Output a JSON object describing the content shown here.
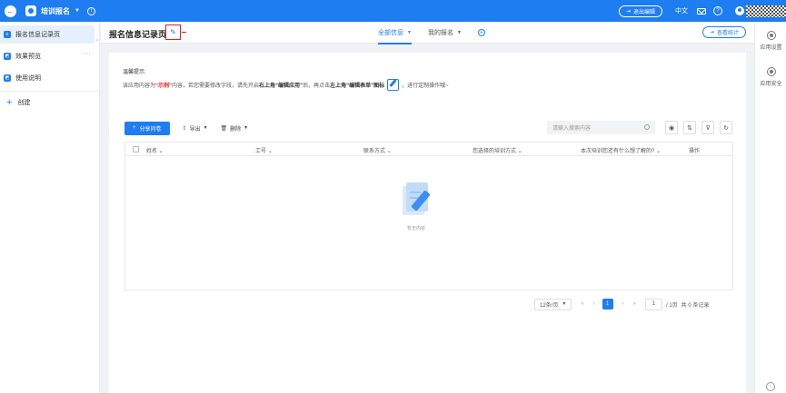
{
  "topbar": {
    "app_name": "培训报名",
    "exit_edit": "退出编辑",
    "language": "中文"
  },
  "sidebar": {
    "items": [
      {
        "label": "报名信息记录页"
      },
      {
        "label": "效果预览"
      },
      {
        "label": "使用说明"
      }
    ],
    "more": "···",
    "create": "创建"
  },
  "header": {
    "title": "报名信息记录页",
    "tabs": [
      {
        "label": "全部信息"
      },
      {
        "label": "我的报名"
      }
    ],
    "stats_button": "查看统计"
  },
  "tip": {
    "title": "温馨提示:",
    "p1": "该应用内容为",
    "p2": "“示例”",
    "p3": "内容，若您需要修改字段，请先开启",
    "p4": "右上角“编辑应用”",
    "p5": "后，再点击",
    "p6": "左上角“编辑表单”图标",
    "p7": "，进行定制操作哦~"
  },
  "toolbar": {
    "share_label": "分享问卷",
    "export_label": "导出",
    "delete_label": "删除",
    "search_placeholder": "请输入搜索内容"
  },
  "table": {
    "columns": [
      "姓名",
      "工号",
      "联系方式",
      "您选择的培训方式",
      "本次培训您还有什么想了解的?",
      "操作"
    ],
    "empty_text": "暂无内容"
  },
  "pagination": {
    "page_size": "12条/页",
    "current_page": "1",
    "page_input": "1",
    "total_pages": "/ 1页",
    "total_records": "共 0 条记录"
  },
  "rightbar": {
    "items": [
      {
        "label": "应用设置"
      },
      {
        "label": "应用安全"
      }
    ]
  },
  "colors": {
    "accent": "#1e7df0",
    "highlight": "#e02020"
  }
}
